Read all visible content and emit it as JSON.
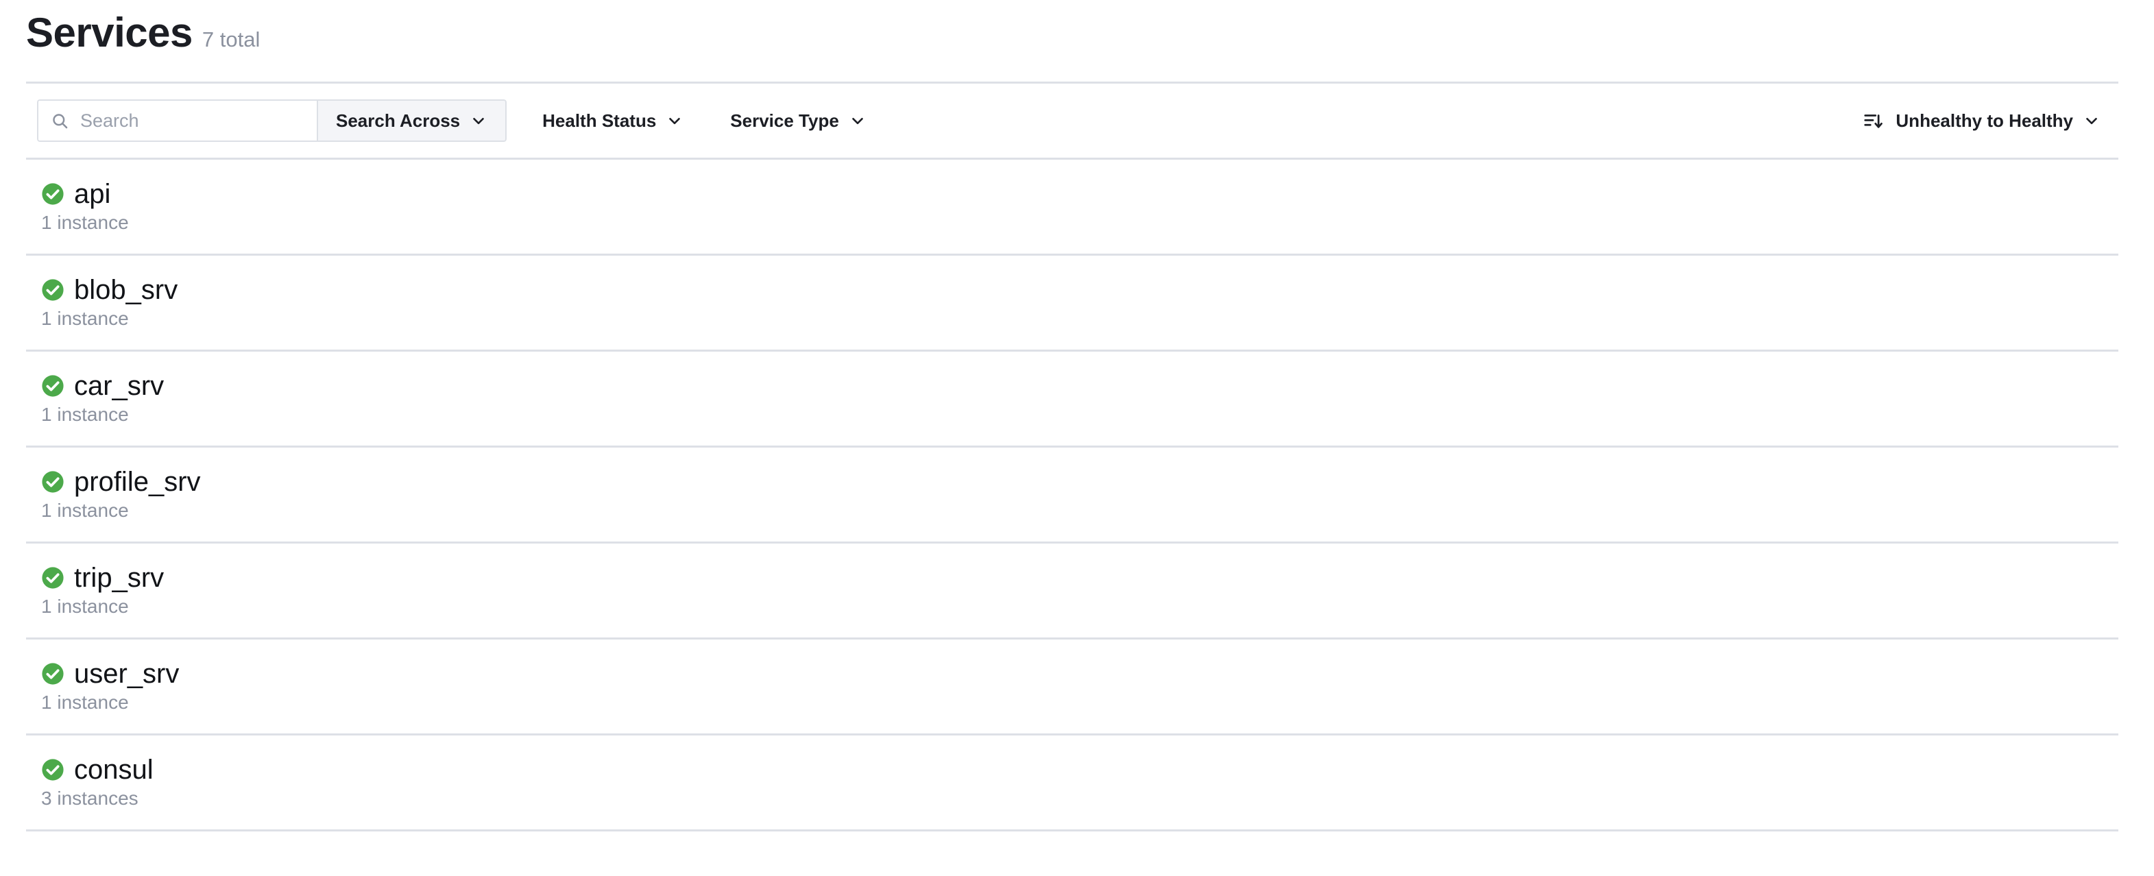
{
  "header": {
    "title": "Services",
    "count_label": "7 total"
  },
  "toolbar": {
    "search": {
      "icon": "search-icon",
      "value": "",
      "placeholder": "Search"
    },
    "search_across": {
      "label": "Search Across",
      "chevron": "chevron-down-icon"
    },
    "filters": [
      {
        "label": "Health Status",
        "chevron": "chevron-down-icon"
      },
      {
        "label": "Service Type",
        "chevron": "chevron-down-icon"
      }
    ],
    "sort": {
      "icon": "sort-descending-icon",
      "label": "Unhealthy to Healthy",
      "chevron": "chevron-down-icon"
    }
  },
  "colors": {
    "healthy": "#4ca94a",
    "border": "#dde0e6",
    "muted_text": "#8b919e",
    "primary_text": "#1c1e24",
    "segment_bg": "#f4f5f8"
  },
  "services": [
    {
      "name": "api",
      "status": "healthy",
      "status_icon": "check-circle-icon",
      "instances": "1 instance"
    },
    {
      "name": "blob_srv",
      "status": "healthy",
      "status_icon": "check-circle-icon",
      "instances": "1 instance"
    },
    {
      "name": "car_srv",
      "status": "healthy",
      "status_icon": "check-circle-icon",
      "instances": "1 instance"
    },
    {
      "name": "profile_srv",
      "status": "healthy",
      "status_icon": "check-circle-icon",
      "instances": "1 instance"
    },
    {
      "name": "trip_srv",
      "status": "healthy",
      "status_icon": "check-circle-icon",
      "instances": "1 instance"
    },
    {
      "name": "user_srv",
      "status": "healthy",
      "status_icon": "check-circle-icon",
      "instances": "1 instance"
    },
    {
      "name": "consul",
      "status": "healthy",
      "status_icon": "check-circle-icon",
      "instances": "3 instances"
    }
  ]
}
